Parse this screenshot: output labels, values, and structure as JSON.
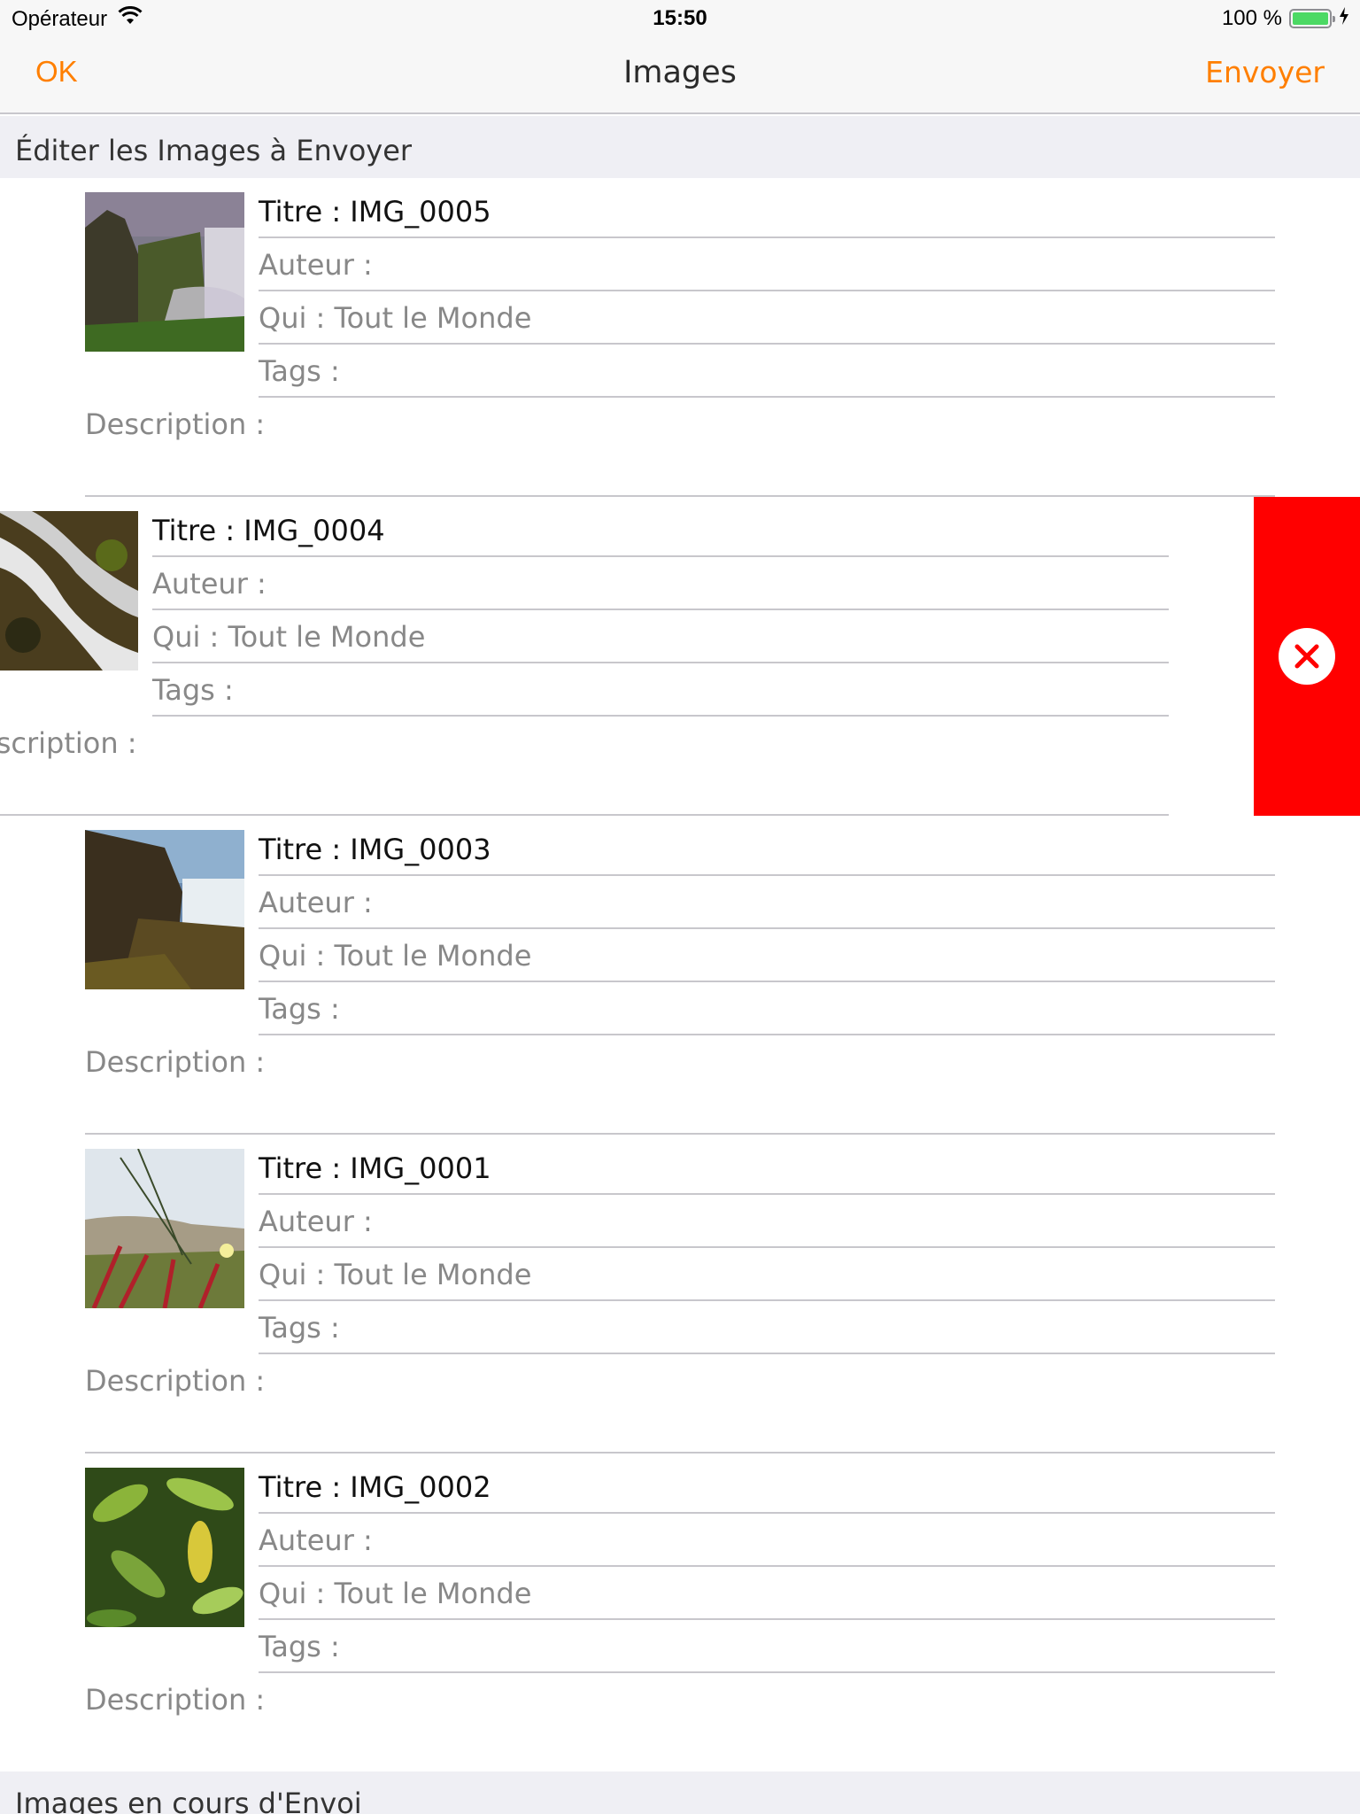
{
  "status_bar": {
    "carrier": "Opérateur",
    "time": "15:50",
    "battery_text": "100 %",
    "battery_level": 1.0,
    "icons": [
      "wifi-icon",
      "battery-icon",
      "charging-icon"
    ]
  },
  "nav": {
    "left_label": "OK",
    "title": "Images",
    "right_label": "Envoyer",
    "accent_color": "#ff7f00"
  },
  "sections": {
    "edit_header": "Éditer les Images à Envoyer",
    "sending_header": "Images en cours d'Envoi"
  },
  "images": [
    {
      "title": "Titre : IMG_0005",
      "author": "Auteur :",
      "who": "Qui : Tout le Monde",
      "tags": "Tags :",
      "description": "Description :",
      "thumbnail": "waterfall-cliff"
    },
    {
      "title": "Titre : IMG_0004",
      "author": "Auteur :",
      "who": "Qui : Tout le Monde",
      "tags": "Tags :",
      "description": "escription :",
      "thumbnail": "rushing-water"
    },
    {
      "title": "Titre : IMG_0003",
      "author": "Auteur :",
      "who": "Qui : Tout le Monde",
      "tags": "Tags :",
      "description": "Description :",
      "thumbnail": "waterfall-rocks"
    },
    {
      "title": "Titre : IMG_0001",
      "author": "Auteur :",
      "who": "Qui : Tout le Monde",
      "tags": "Tags :",
      "description": "Description :",
      "thumbnail": "dune-grass"
    },
    {
      "title": "Titre : IMG_0002",
      "author": "Auteur :",
      "who": "Qui : Tout le Monde",
      "tags": "Tags :",
      "description": "Description :",
      "thumbnail": "green-leaves"
    }
  ],
  "delete_action": {
    "icon": "close-icon",
    "color": "#ff0000"
  }
}
